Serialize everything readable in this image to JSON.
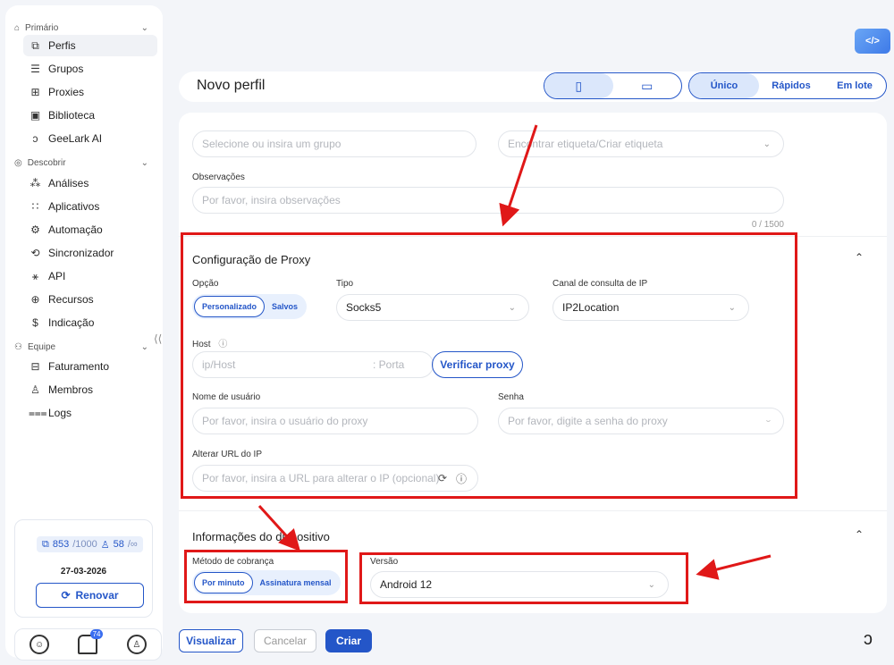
{
  "sidebar": {
    "primary_label": "Primário",
    "discover_label": "Descobrir",
    "team_label": "Equipe",
    "primary_items": [
      {
        "label": "Perfis",
        "icon": "profile-icon"
      },
      {
        "label": "Grupos",
        "icon": "list-icon"
      },
      {
        "label": "Proxies",
        "icon": "proxy-icon"
      },
      {
        "label": "Biblioteca",
        "icon": "library-icon"
      },
      {
        "label": "GeeLark AI",
        "icon": "ai-icon"
      }
    ],
    "discover_items": [
      {
        "label": "Análises",
        "icon": "analytics-icon"
      },
      {
        "label": "Aplicativos",
        "icon": "apps-icon"
      },
      {
        "label": "Automação",
        "icon": "automation-icon"
      },
      {
        "label": "Sincronizador",
        "icon": "sync-icon"
      },
      {
        "label": "API",
        "icon": "api-icon"
      },
      {
        "label": "Recursos",
        "icon": "resources-icon"
      },
      {
        "label": "Indicação",
        "icon": "referral-icon"
      }
    ],
    "team_items": [
      {
        "label": "Faturamento",
        "icon": "billing-icon"
      },
      {
        "label": "Membros",
        "icon": "members-icon"
      },
      {
        "label": "Logs",
        "icon": "logs-icon"
      }
    ],
    "quota": {
      "profiles": "853",
      "profiles_total": "/1000",
      "members": "58",
      "members_total": "/∞",
      "date": "27-03-2026",
      "renew_label": "Renovar"
    },
    "notification_count": "74"
  },
  "header": {
    "title": "Novo perfil",
    "modes": [
      "Único",
      "Rápidos",
      "Em lote"
    ]
  },
  "form": {
    "group_placeholder": "Selecione ou insira um grupo",
    "tag_placeholder": "Encontrar etiqueta/Criar etiqueta",
    "notes_label": "Observações",
    "notes_placeholder": "Por favor, insira observações",
    "notes_counter": "0 / 1500",
    "proxy": {
      "section_title": "Configuração de Proxy",
      "option_label": "Opção",
      "options": [
        "Personalizado",
        "Salvos"
      ],
      "type_label": "Tipo",
      "type_value": "Socks5",
      "channel_label": "Canal de consulta de IP",
      "channel_value": "IP2Location",
      "host_label": "Host",
      "host_placeholder": "ip/Host",
      "port_placeholder": ": Porta",
      "verify_label": "Verificar proxy",
      "user_label": "Nome de usuário",
      "user_placeholder": "Por favor, insira o usuário do proxy",
      "password_label": "Senha",
      "password_placeholder": "Por favor, digite a senha do proxy",
      "change_url_label": "Alterar URL do IP",
      "change_url_placeholder": "Por favor, insira a URL para alterar o IP (opcional)"
    },
    "device": {
      "section_title": "Informações do dispositivo",
      "billing_label": "Método de cobrança",
      "billing_options": [
        "Por minuto",
        "Assinatura mensal"
      ],
      "version_label": "Versão",
      "version_value": "Android 12"
    }
  },
  "footer": {
    "preview_label": "Visualizar",
    "cancel_label": "Cancelar",
    "create_label": "Criar"
  },
  "colors": {
    "accent": "#2456c8",
    "annotation": "#e01818"
  }
}
